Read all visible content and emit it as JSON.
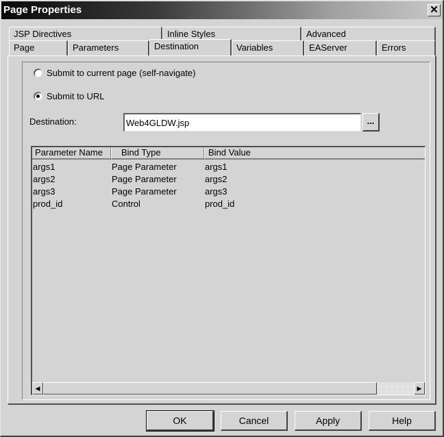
{
  "window": {
    "title": "Page Properties",
    "close_icon": "close-icon"
  },
  "tabs": {
    "row_back": [
      {
        "label": "JSP Directives"
      },
      {
        "label": "Inline Styles"
      },
      {
        "label": "Advanced"
      }
    ],
    "row_front": [
      {
        "label": "Page"
      },
      {
        "label": "Parameters"
      },
      {
        "label": "Destination",
        "active": true
      },
      {
        "label": "Variables"
      },
      {
        "label": "EAServer"
      },
      {
        "label": "Errors"
      }
    ]
  },
  "destination": {
    "radio_self": {
      "label": "Submit to current page (self-navigate)",
      "checked": false
    },
    "radio_url": {
      "label": "Submit to URL",
      "checked": true
    },
    "field_label": "Destination:",
    "field_value": "Web4GLDW.jsp",
    "browse_label": "..."
  },
  "params_table": {
    "columns": [
      "Parameter Name",
      "Bind Type",
      "Bind Value"
    ],
    "rows": [
      [
        "args1",
        "Page Parameter",
        "args1"
      ],
      [
        "args2",
        "Page Parameter",
        "args2"
      ],
      [
        "args3",
        "Page Parameter",
        "args3"
      ],
      [
        "prod_id",
        "Control",
        "prod_id"
      ]
    ],
    "scroll_left_icon": "◀",
    "scroll_right_icon": "▶"
  },
  "buttons": {
    "ok": "OK",
    "cancel": "Cancel",
    "apply": "Apply",
    "help": "Help"
  }
}
